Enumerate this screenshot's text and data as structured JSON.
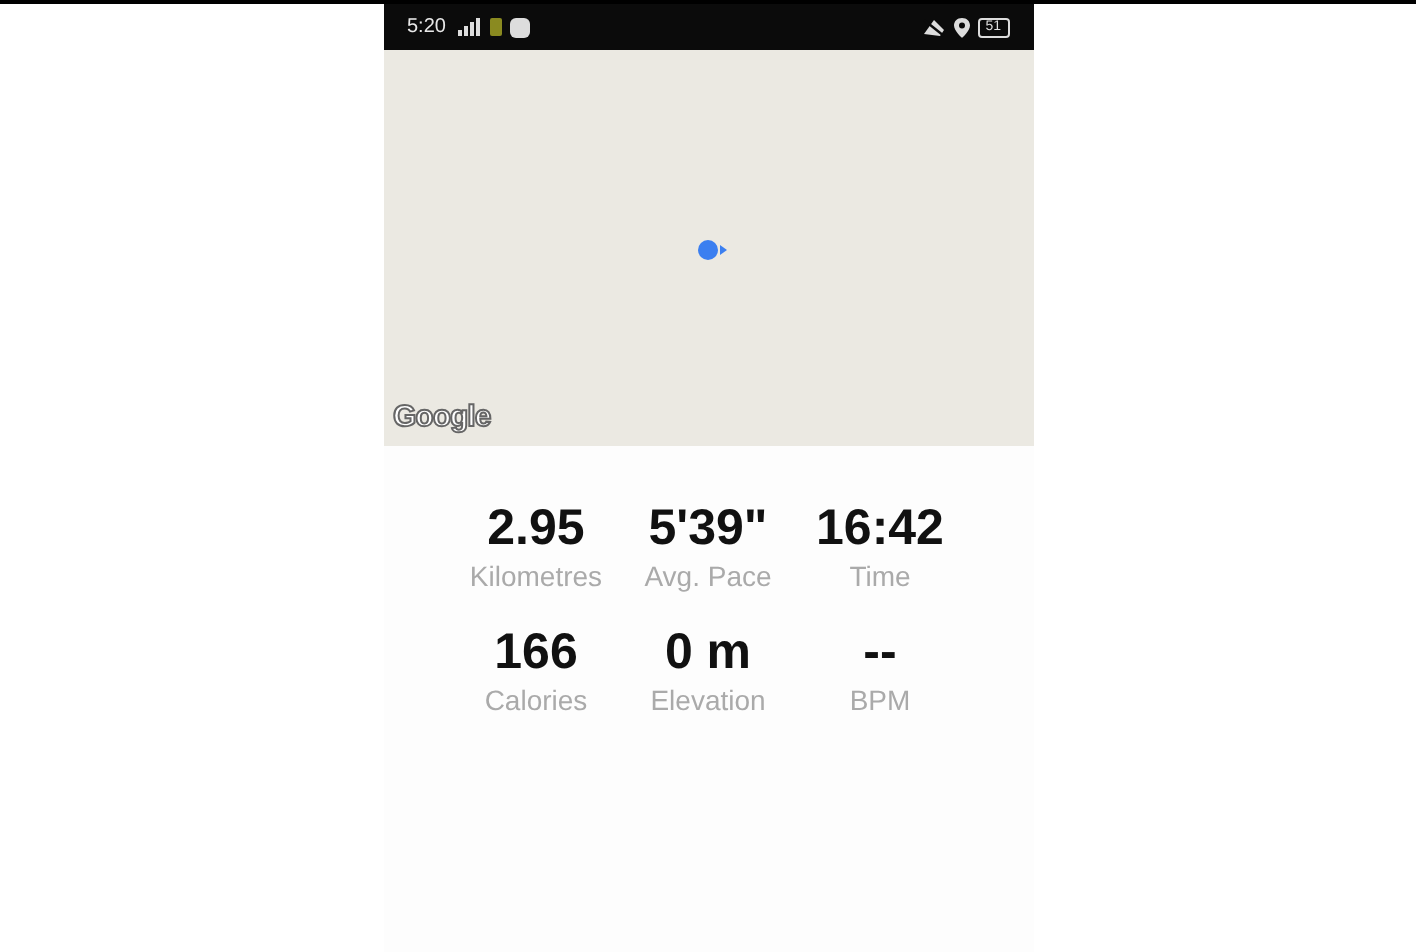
{
  "status_bar": {
    "time": "5:20",
    "battery": "51"
  },
  "map": {
    "attribution": "Google"
  },
  "stats": [
    {
      "value": "2.95",
      "label": "Kilometres"
    },
    {
      "value": "5'39\"",
      "label": "Avg. Pace"
    },
    {
      "value": "16:42",
      "label": "Time"
    },
    {
      "value": "166",
      "label": "Calories"
    },
    {
      "value": "0 m",
      "label": "Elevation"
    },
    {
      "value": "--",
      "label": "BPM"
    }
  ]
}
